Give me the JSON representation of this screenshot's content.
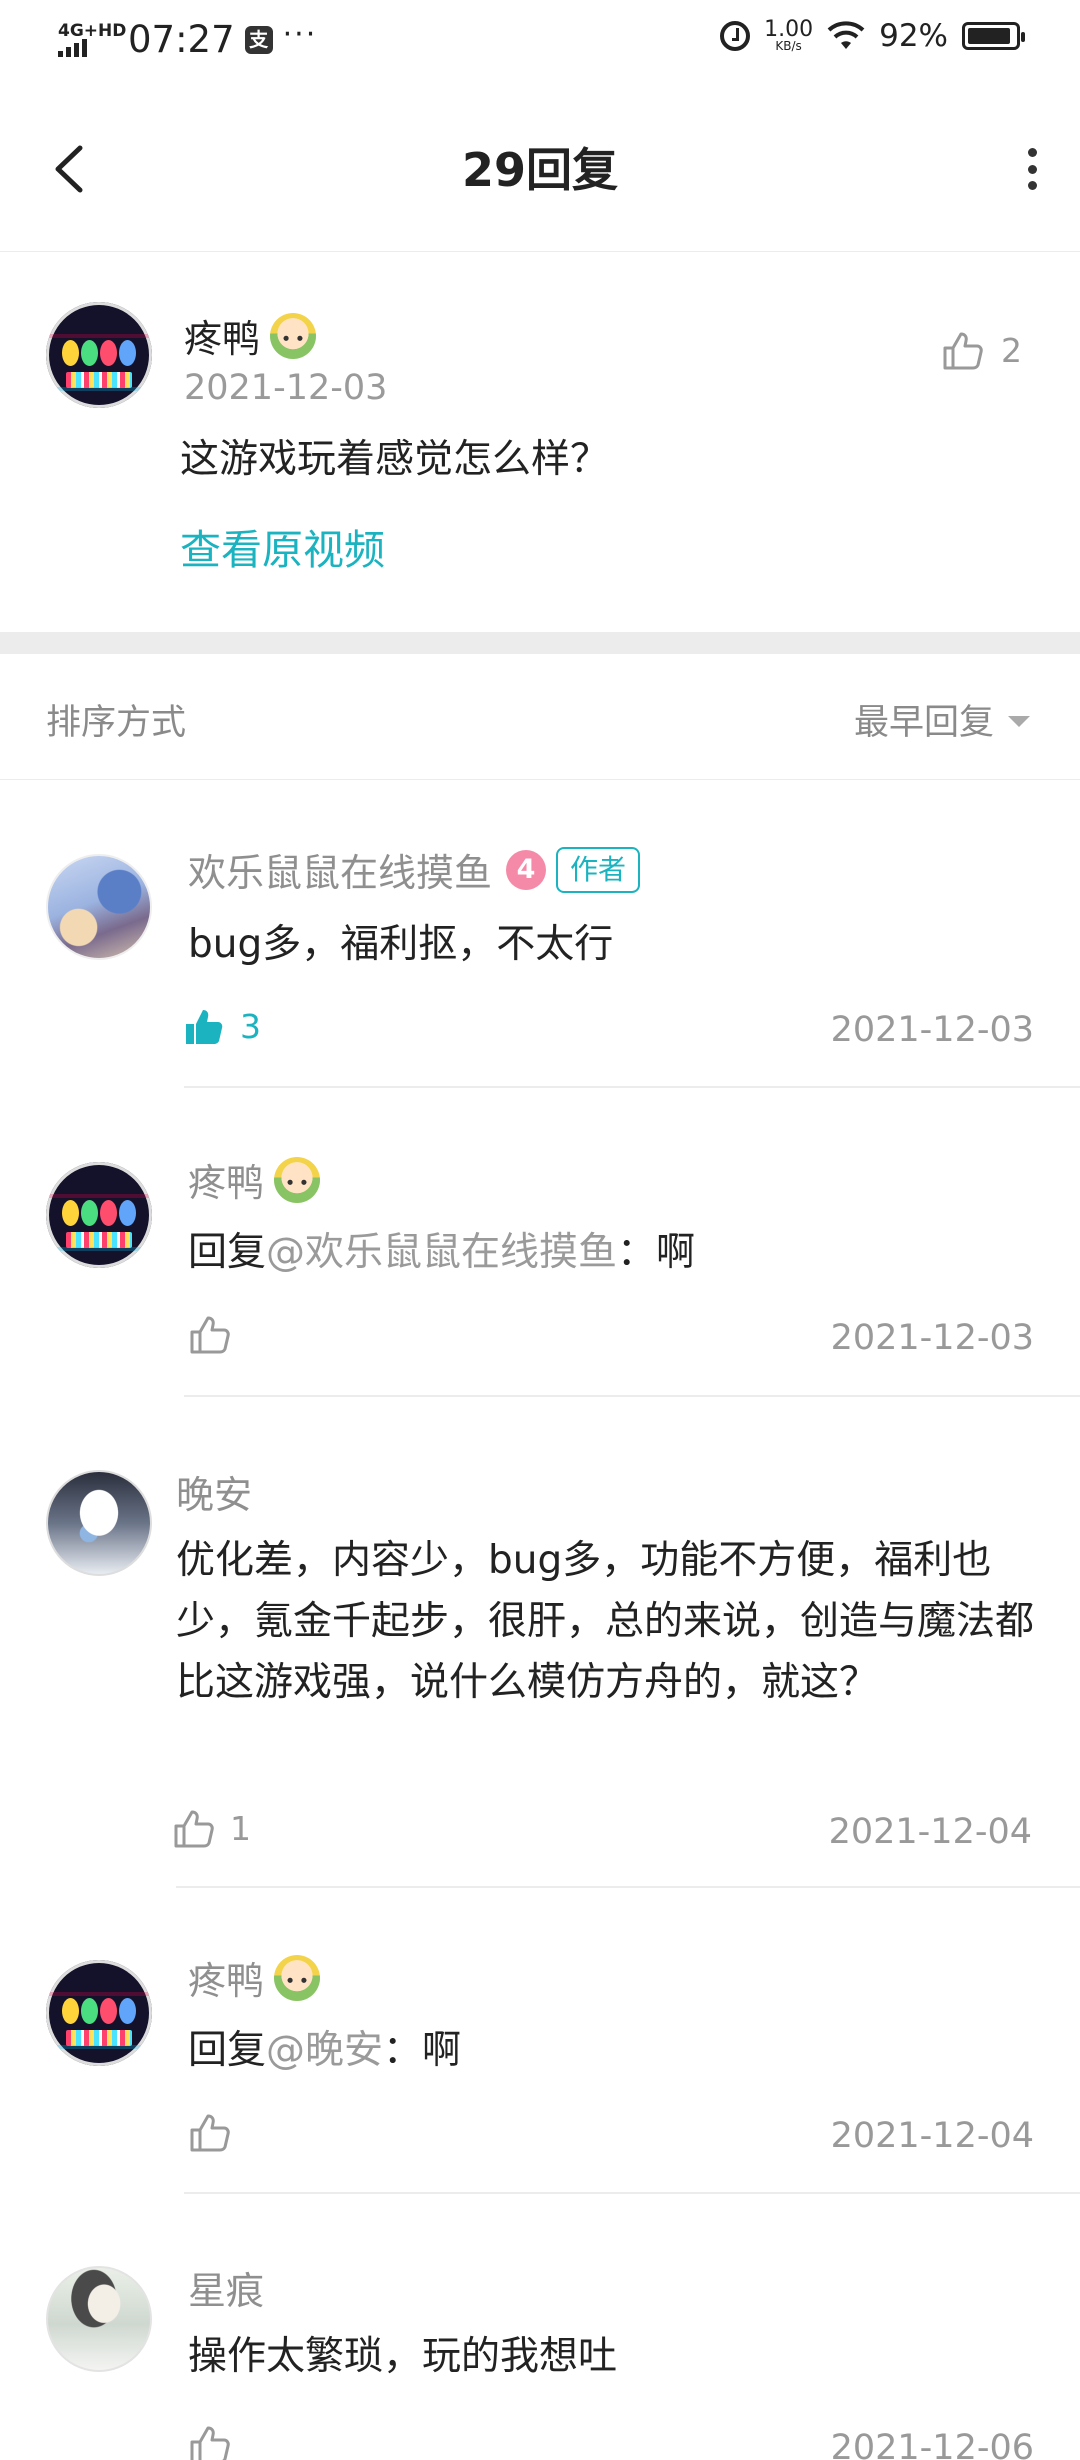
{
  "status_bar": {
    "network": "4G+HD",
    "time": "07:27",
    "app_icon_glyph": "支",
    "overflow_dots": "···",
    "speed_value": "1.00",
    "speed_unit": "KB/s",
    "battery_pct": "92%"
  },
  "header": {
    "title": "29回复"
  },
  "post": {
    "author": "疼鸭",
    "date": "2021-12-03",
    "text": "这游戏玩着感觉怎么样？",
    "link": "查看原视频",
    "likes": "2"
  },
  "sort": {
    "label": "排序方式",
    "selected": "最早回复"
  },
  "replies": [
    {
      "author": "欢乐鼠鼠在线摸鱼",
      "level": "4",
      "tag": "作者",
      "text": "bug多，福利抠，不太行",
      "likes": "3",
      "date": "2021-12-03"
    },
    {
      "author": "疼鸭",
      "reply_prefix": "回复",
      "mention": "@欢乐鼠鼠在线摸鱼",
      "text": "：啊",
      "date": "2021-12-03"
    },
    {
      "author": "晚安",
      "text": "优化差，内容少，bug多，功能不方便，福利也少，氪金千起步，很肝，总的来说，创造与魔法都比这游戏强，说什么模仿方舟的，就这？",
      "likes": "1",
      "date": "2021-12-04"
    },
    {
      "author": "疼鸭",
      "reply_prefix": "回复",
      "mention": "@晚安",
      "text": "：啊",
      "date": "2021-12-04"
    },
    {
      "author": "星痕",
      "text": "操作太繁琐，玩的我想吐",
      "date": "2021-12-06"
    }
  ],
  "colors": {
    "accent": "#1ab3bf",
    "level_badge": "#f58aa8"
  }
}
